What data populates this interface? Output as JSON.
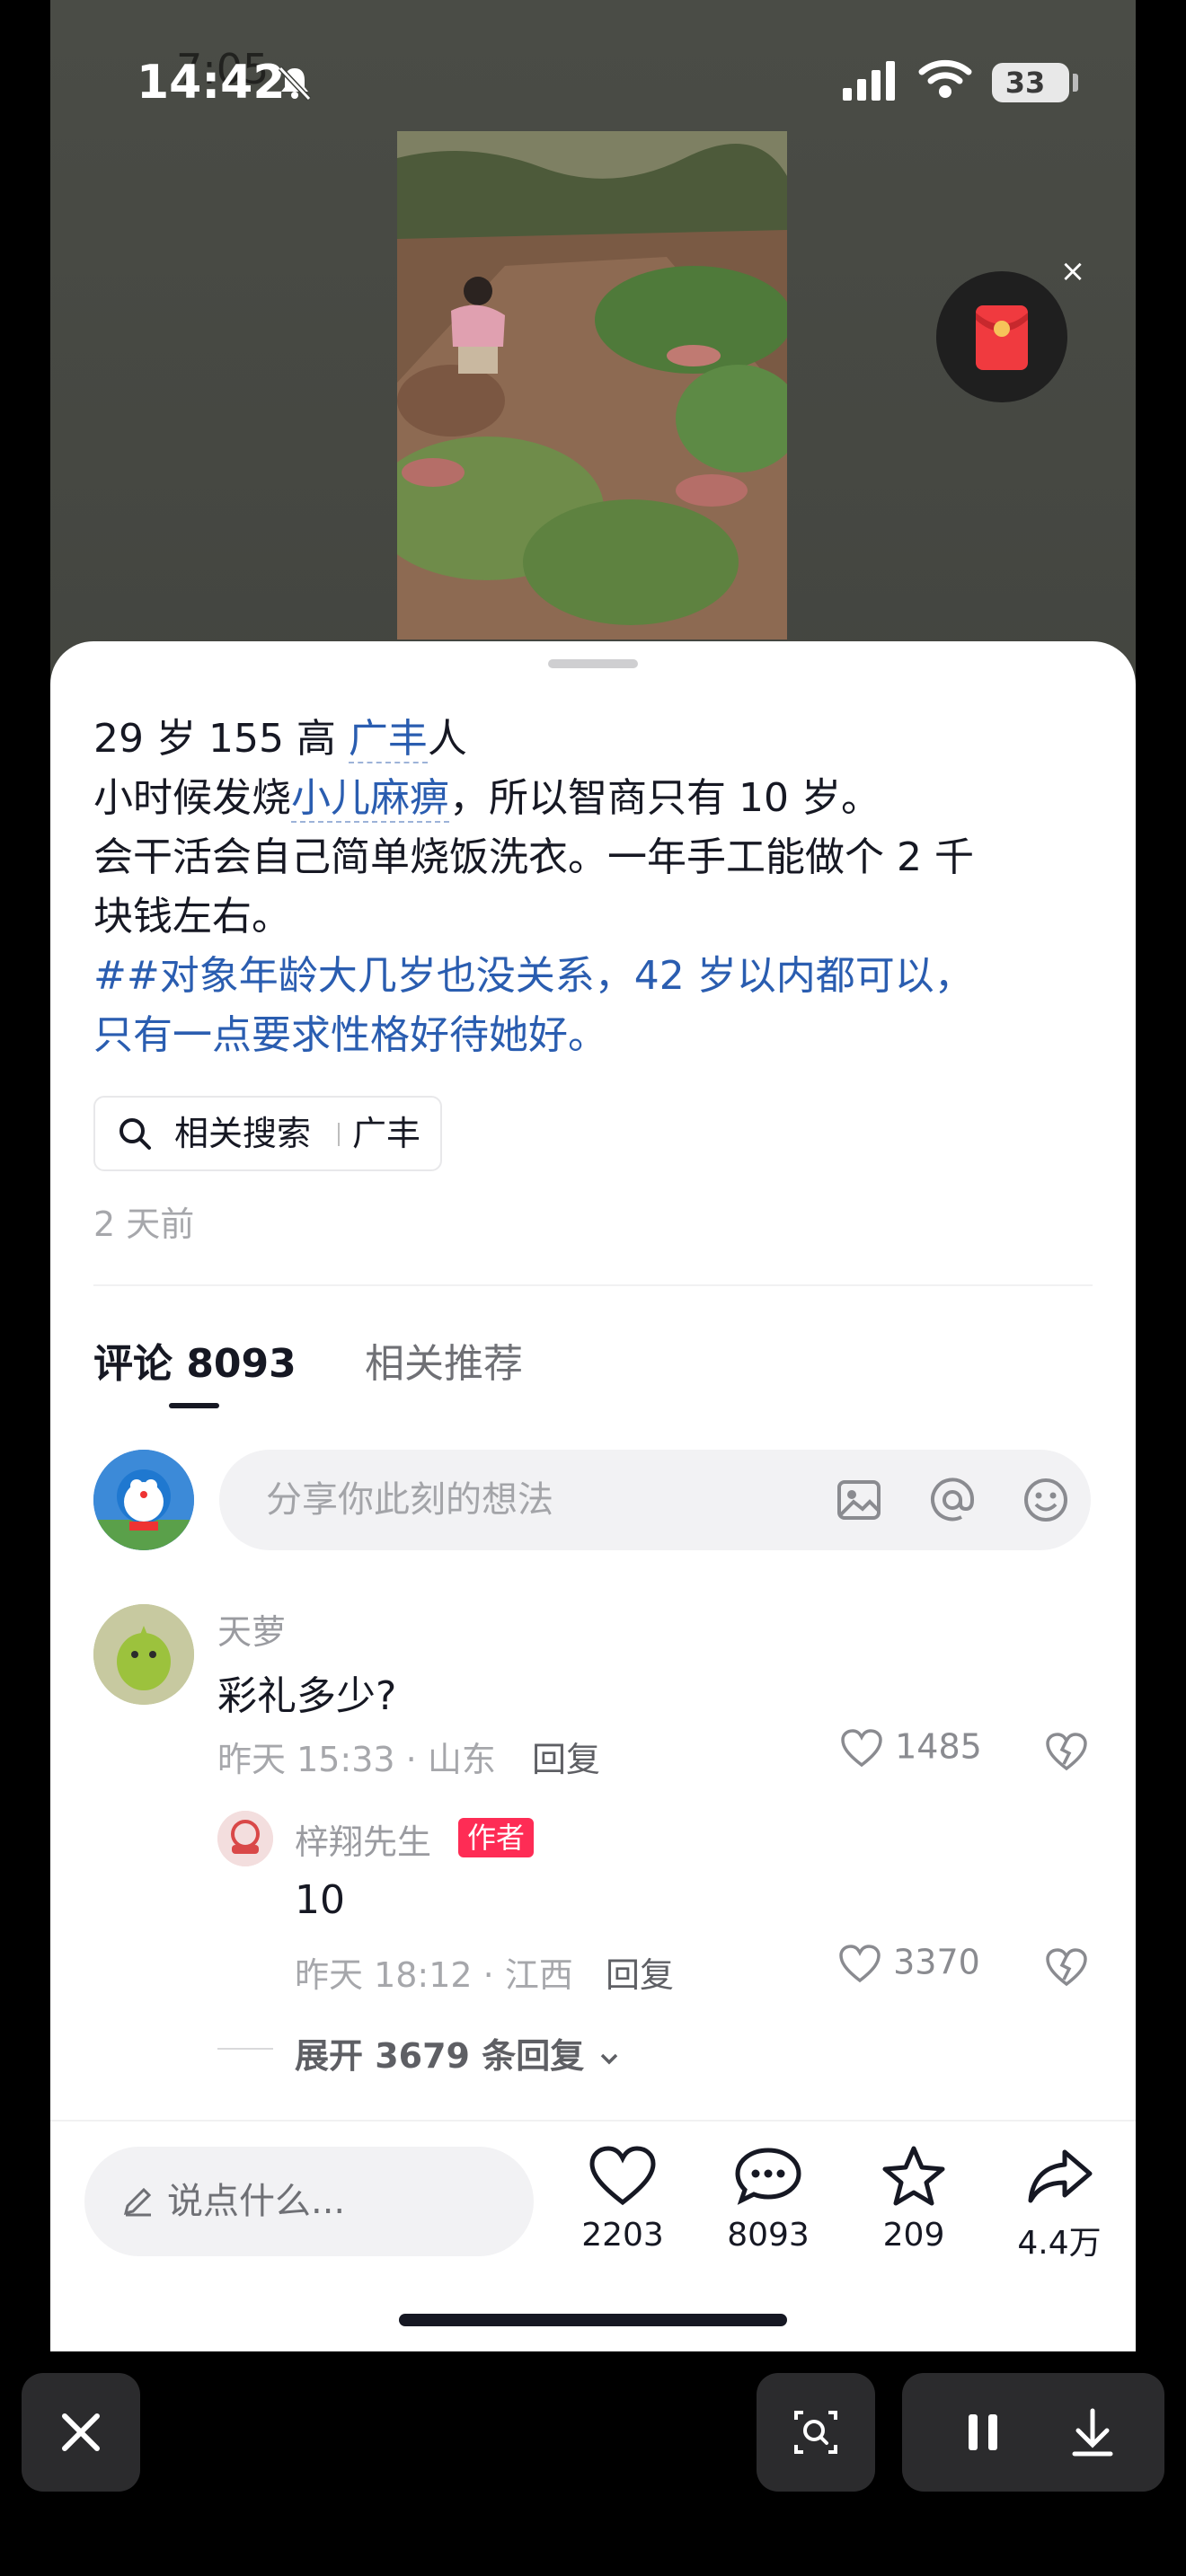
{
  "status_bar": {
    "time": "14:42",
    "time_ghost": "7:05",
    "battery": "33"
  },
  "post": {
    "line1_pre": "29 岁 155 高 ",
    "line1_link": "广丰",
    "line1_post": "人",
    "line2_pre": "小时候发烧",
    "line2_link": "小儿麻痹",
    "line2_post": "，所以智商只有 10 岁。",
    "line3": "会干活会自己简单烧饭洗衣。一年手工能做个 2 千",
    "line4": "块钱左右。",
    "hashtag_line1": "##对象年龄大几岁也没关系，42 岁以内都可以，",
    "hashtag_line2": "只有一点要求性格好待她好。",
    "related_search_label": "相关搜索",
    "related_search_term": "广丰",
    "posted": "2 天前"
  },
  "tabs": {
    "comments": "评论 8093",
    "related": "相关推荐"
  },
  "comment_input": {
    "placeholder": "分享你此刻的想法"
  },
  "comments": [
    {
      "user": "天萝",
      "text": "彩礼多少?",
      "meta": "昨天 15:33 · 山东",
      "reply": "回复",
      "likes": "1485"
    }
  ],
  "reply": {
    "user": "梓翔先生",
    "badge": "作者",
    "text": "10",
    "meta": "昨天 18:12 · 江西",
    "reply": "回复",
    "likes": "3370"
  },
  "expand_replies": "展开 3679 条回复",
  "bottom_bar": {
    "say_placeholder": "说点什么...",
    "likes": "2203",
    "comments": "8093",
    "favorites": "209",
    "shares": "4.4万"
  },
  "colors": {
    "accent_red": "#fe2c55",
    "link_blue": "#2a5db0"
  }
}
